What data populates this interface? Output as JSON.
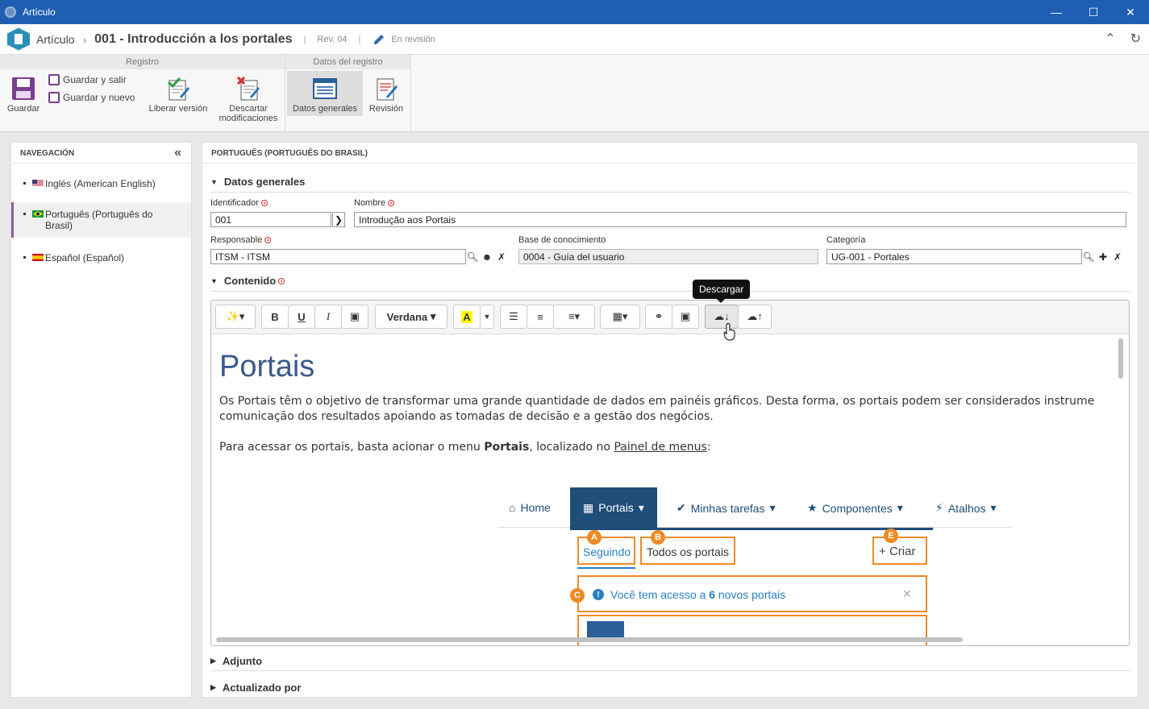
{
  "window": {
    "title": "Artículo"
  },
  "header": {
    "crumb": "Artículo",
    "doc_title": "001 - Introducción a los portales",
    "revision": "Rev. 04",
    "status": "En revisión"
  },
  "ribbon": {
    "group_registro": "Registro",
    "group_datos": "Datos del registro",
    "save": "Guardar",
    "save_exit": "Guardar y salir",
    "save_new": "Guardar y nuevo",
    "release": "Liberar versión",
    "discard_1": "Descartar",
    "discard_2": "modificaciones",
    "general_data": "Datos generales",
    "review": "Revisión"
  },
  "nav": {
    "title": "NAVEGACIÓN",
    "items": [
      {
        "label": "Inglés (American English)"
      },
      {
        "label": "Português (Português do Brasil)"
      },
      {
        "label": "Español (Español)"
      }
    ]
  },
  "main": {
    "lang_title": "PORTUGUÊS (PORTUGUÊS DO BRASIL)",
    "general_section": "Datos generales",
    "fields": {
      "identifier_label": "Identificador",
      "identifier_value": "001",
      "name_label": "Nombre",
      "name_value": "Introdução aos Portais",
      "responsible_label": "Responsable",
      "responsible_value": "ITSM - ITSM",
      "kb_label": "Base de conocimiento",
      "kb_value": "0004 - Guía del usuario",
      "category_label": "Categoría",
      "category_value": "UG-001 - Portales"
    },
    "content_section": "Contenido",
    "attach_section": "Adjunto",
    "updated_section": "Actualizado por"
  },
  "editor": {
    "font": "Verdana",
    "tooltip": "Descargar",
    "heading": "Portais",
    "p1": "Os Portais têm o objetivo de transformar uma grande quantidade de dados em painéis gráficos. Desta forma, os portais podem ser considerados instrume comunicação dos resultados apoiando as tomadas de decisão e a gestão dos negócios.",
    "p2_a": "Para acessar os portais, basta acionar o menu ",
    "p2_b": "Portais",
    "p2_c": ", localizado no ",
    "p2_link": "Painel de menus",
    "p2_d": ":"
  },
  "screenshot": {
    "menu": [
      "Home",
      "Portais",
      "Minhas tarefas",
      "Componentes",
      "Atalhos"
    ],
    "tab_following": "Seguindo",
    "tab_all": "Todos os portais",
    "create": "Criar",
    "notice_a": "Você tem acesso a ",
    "notice_count": "6",
    "notice_b": " novos portais",
    "badges": [
      "A",
      "B",
      "C",
      "E"
    ]
  },
  "colors": {
    "titlebar": "#1e5fb3",
    "accent": "#8e5aa8",
    "orange": "#f08a24",
    "portal_nav": "#1f4e79"
  }
}
